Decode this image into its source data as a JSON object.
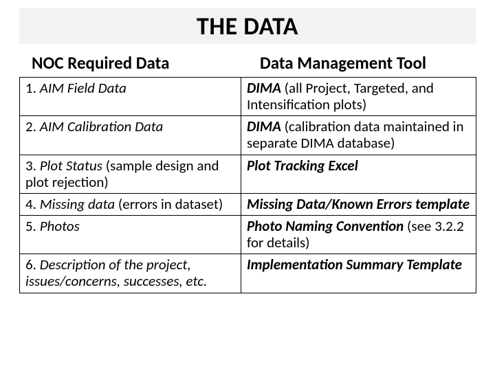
{
  "title": "THE DATA",
  "colLeftHeader": "NOC Required Data",
  "colRightHeader": "Data Management Tool",
  "rows": [
    {
      "num": "1.  ",
      "leftItalic": "AIM Field Data",
      "leftRest": "",
      "rightBold": "DIMA",
      "rightRest": " (all Project, Targeted, and Intensification plots)"
    },
    {
      "num": "2.  ",
      "leftItalic": "AIM Calibration Data",
      "leftRest": "",
      "rightBold": "DIMA",
      "rightRest": " (calibration data maintained in separate DIMA database)"
    },
    {
      "num": "3.  ",
      "leftItalic": "Plot Status",
      "leftRest": " (sample design and plot rejection)",
      "rightBold": "Plot Tracking Excel",
      "rightRest": ""
    },
    {
      "num": "4.  ",
      "leftItalic": "Missing data",
      "leftRest": " (errors in dataset)",
      "rightBold": "Missing Data/Known Errors template",
      "rightRest": ""
    },
    {
      "num": "5.  ",
      "leftItalic": "Photos",
      "leftRest": "",
      "rightBold": "Photo Naming Convention",
      "rightRest": " (see 3.2.2 for details)"
    },
    {
      "num": "6.  ",
      "leftItalic": "Description of the project, issues/concerns, successes, etc.",
      "leftRest": "",
      "rightBold": "Implementation Summary Template",
      "rightRest": ""
    }
  ]
}
